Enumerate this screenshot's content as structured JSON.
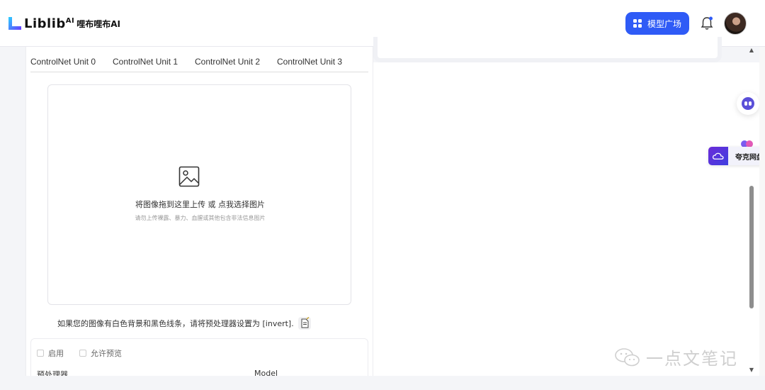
{
  "header": {
    "logo_text": "Liblib",
    "logo_ai": "AI",
    "logo_sub": "哩布哩布AI",
    "market_button": "模型广场"
  },
  "controlnet": {
    "tabs": [
      {
        "label": "ControlNet Unit 0"
      },
      {
        "label": "ControlNet Unit 1"
      },
      {
        "label": "ControlNet Unit 2"
      },
      {
        "label": "ControlNet Unit 3"
      }
    ],
    "upload": {
      "main_text": "将图像拖到这里上传 或 点我选择图片",
      "sub_text": "请勿上传裸露、暴力、血腥或其他包含非法信息图片"
    },
    "invert_hint": "如果您的图像有白色背景和黑色线条，请将预处理器设置为 [invert].",
    "options": {
      "enable_label": "启用",
      "preview_label": "允许预览",
      "preprocessor_label": "预处理器",
      "model_label": "Model"
    }
  },
  "widgets": {
    "quark_label": "夸克网盘"
  },
  "watermark": {
    "text": "一点文笔记"
  },
  "colors": {
    "accent": "#2f5bf6",
    "quark": "#5a3de0"
  }
}
